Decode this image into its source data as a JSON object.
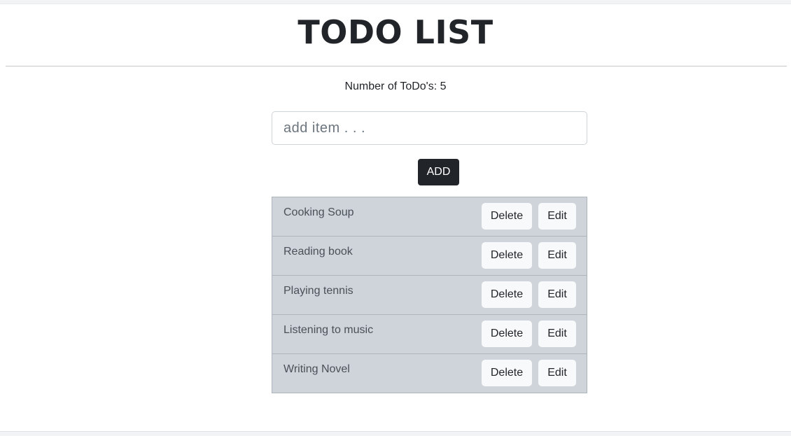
{
  "header": {
    "title": "TODO LIST"
  },
  "summary": {
    "count_text": "Number of ToDo's: 5"
  },
  "form": {
    "input_value": "",
    "input_placeholder": "add item . . .",
    "add_label": "ADD"
  },
  "todos": [
    {
      "text": "Cooking Soup",
      "delete_label": "Delete",
      "edit_label": "Edit"
    },
    {
      "text": "Reading book",
      "delete_label": "Delete",
      "edit_label": "Edit"
    },
    {
      "text": "Playing tennis",
      "delete_label": "Delete",
      "edit_label": "Edit"
    },
    {
      "text": "Listening to music",
      "delete_label": "Delete",
      "edit_label": "Edit"
    },
    {
      "text": "Writing Novel",
      "delete_label": "Delete",
      "edit_label": "Edit"
    }
  ],
  "colors": {
    "title_text": "#212529",
    "add_button_bg": "#212529",
    "list_item_bg": "#ced4da",
    "list_border": "#adb5bd",
    "light_button_bg": "#f8f9fa"
  }
}
